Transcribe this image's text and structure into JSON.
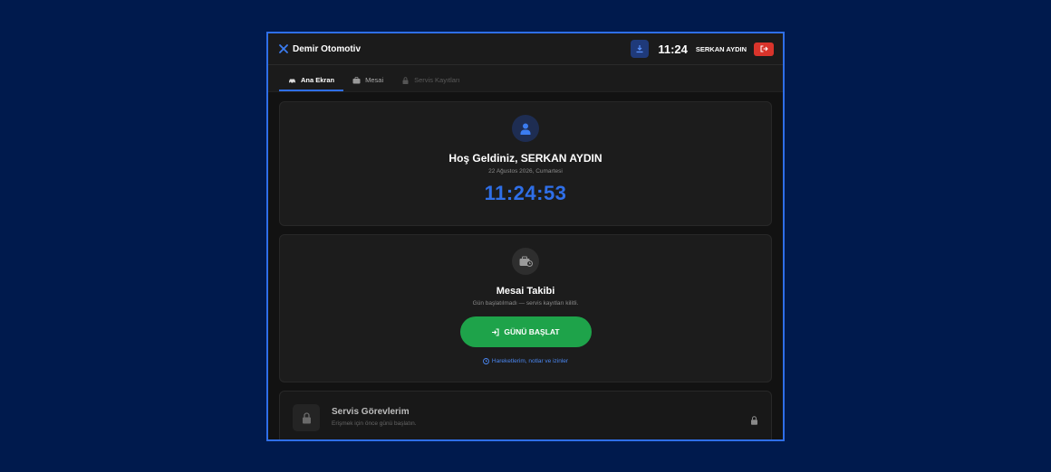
{
  "header": {
    "brand": "Demir Otomotiv",
    "time": "11:24",
    "user": "SERKAN AYDIN",
    "icons": {
      "brand": "wrench-icon",
      "download": "download-icon",
      "logout": "logout-icon"
    }
  },
  "tabs": [
    {
      "label": "Ana Ekran",
      "icon": "car-icon",
      "state": "active"
    },
    {
      "label": "Mesai",
      "icon": "briefcase-icon",
      "state": "normal"
    },
    {
      "label": "Servis Kayıtları",
      "icon": "lock-icon",
      "state": "disabled"
    }
  ],
  "welcome": {
    "title": "Hoş Geldiniz, SERKAN AYDIN",
    "date": "22 Ağustos 2026, Cumartesi",
    "clock": "11:24:53"
  },
  "shift": {
    "title": "Mesai Takibi",
    "subtitle": "Gün başlatılmadı — servis kayıtları kilitli.",
    "start_button": "GÜNÜ BAŞLAT",
    "history_link": "Hareketlerim, notlar ve izinler"
  },
  "service": {
    "title": "Servis Görevlerim",
    "subtitle": "Erişmek için önce günü başlatın."
  },
  "colors": {
    "accent": "#2f6fe8",
    "success": "#1ea34a",
    "danger": "#d9342b",
    "background": "#001a4d"
  }
}
